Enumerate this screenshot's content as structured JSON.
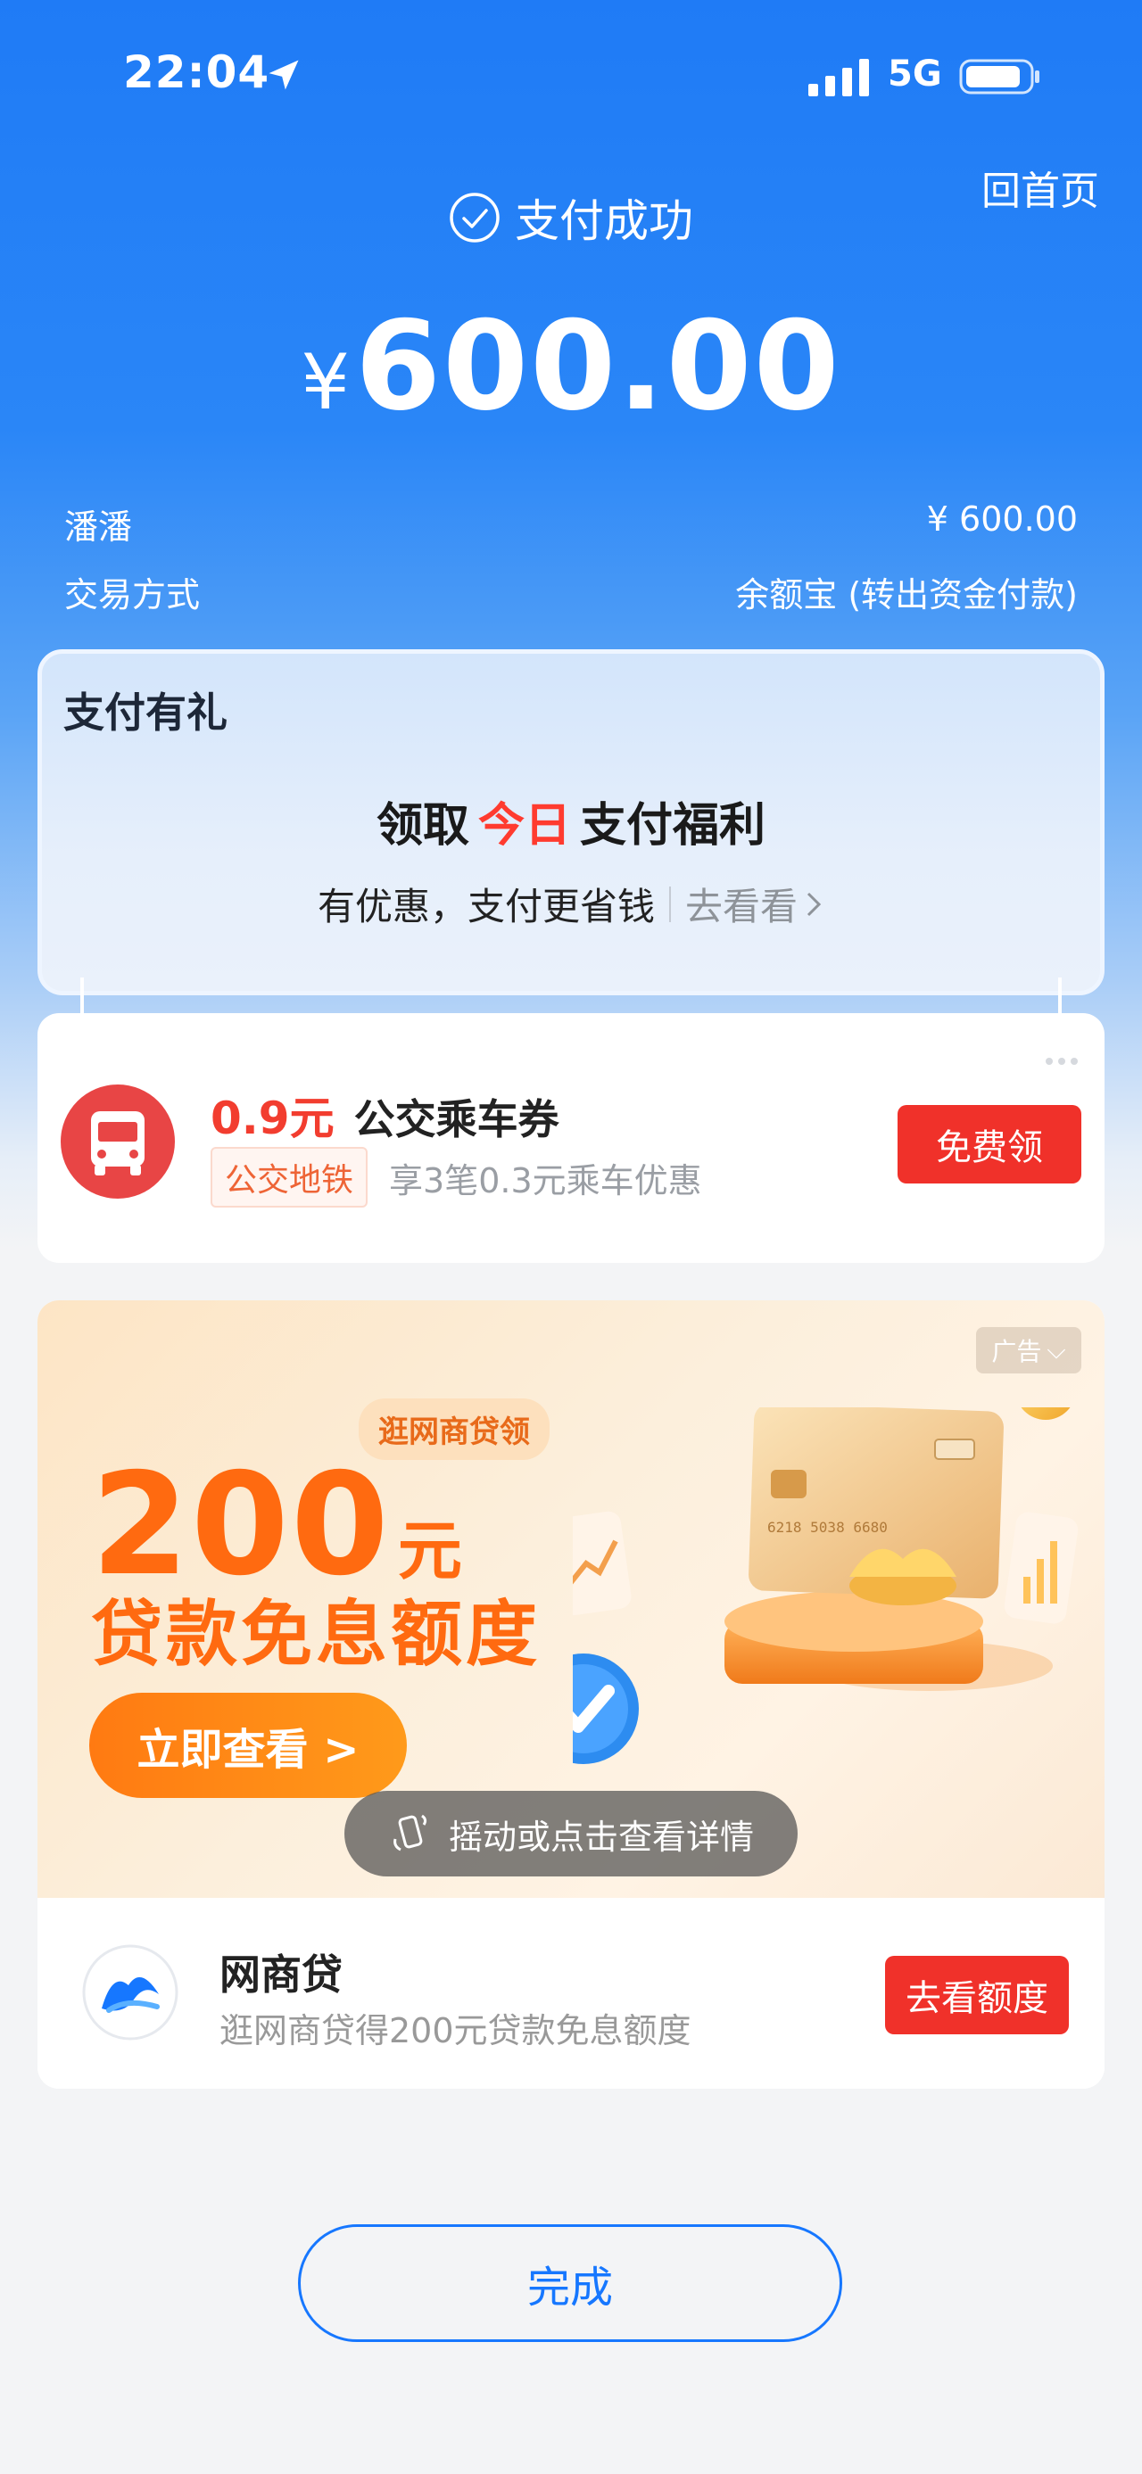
{
  "status_bar": {
    "time": "22:04",
    "network": "5G"
  },
  "header": {
    "home_link": "回首页",
    "status_title": "支付成功",
    "currency_symbol": "¥",
    "amount": "600.00"
  },
  "details": {
    "payee": "潘潘",
    "payee_amount": "¥ 600.00",
    "method_label": "交易方式",
    "method_value": "余额宝 (转出资金付款)"
  },
  "gift": {
    "title": "支付有礼",
    "headline_prefix": "领取",
    "headline_highlight": "今日",
    "headline_suffix": "支付福利",
    "subtitle": "有优惠，支付更省钱",
    "link": "去看看"
  },
  "coupon": {
    "amount": "0.9元",
    "name": "公交乘车券",
    "tag": "公交地铁",
    "desc": "享3笔0.3元乘车优惠",
    "button": "免费领"
  },
  "ad": {
    "badge": "广告",
    "chip": "逛网商贷领",
    "big_number": "200",
    "big_unit": "元",
    "subtitle": "贷款免息额度",
    "cta": "立即查看 >",
    "shake_hint": "摇动或点击查看详情",
    "card_number": "6218 5038 6680",
    "brand_name": "网商贷",
    "brand_desc": "逛网商贷得200元贷款免息额度",
    "brand_button": "去看额度"
  },
  "footer": {
    "done_button": "完成"
  },
  "colors": {
    "primary_blue": "#1677ff",
    "danger_red": "#f0312a",
    "promo_orange": "#ff6a10"
  }
}
